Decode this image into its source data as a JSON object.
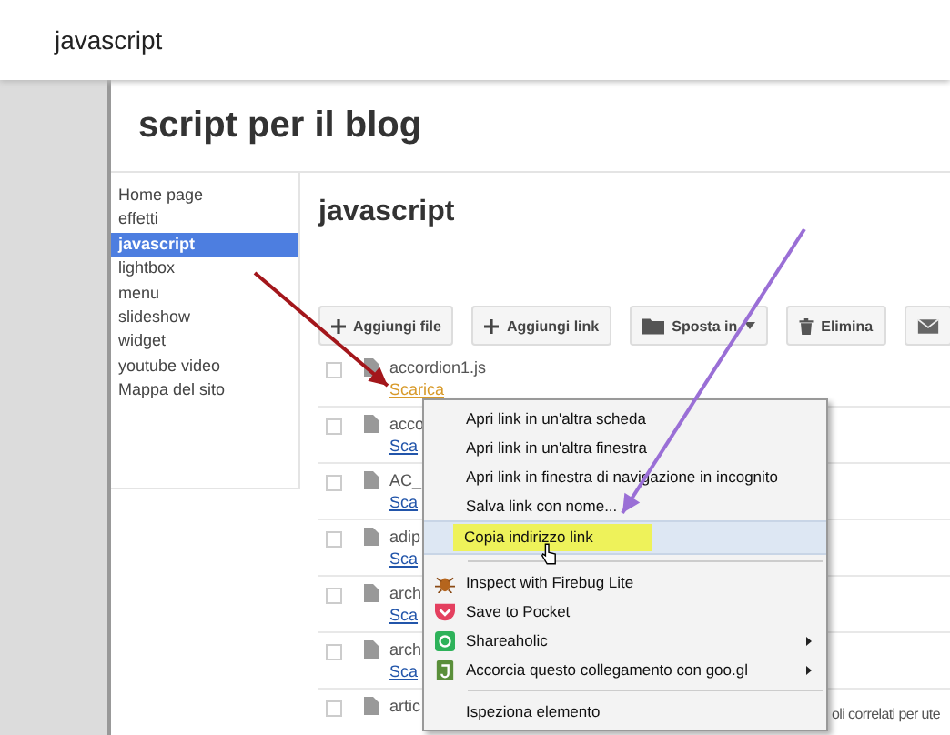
{
  "header": {
    "title": "javascript"
  },
  "site_title": "script per il blog",
  "sidebar": {
    "items": [
      {
        "label": "Home page",
        "selected": false
      },
      {
        "label": "effetti",
        "selected": false
      },
      {
        "label": "javascript",
        "selected": true
      },
      {
        "label": "lightbox",
        "selected": false
      },
      {
        "label": "menu",
        "selected": false
      },
      {
        "label": "slideshow",
        "selected": false
      },
      {
        "label": "widget",
        "selected": false
      },
      {
        "label": "youtube video",
        "selected": false
      },
      {
        "label": "Mappa del sito",
        "selected": false
      }
    ]
  },
  "content": {
    "heading": "javascript",
    "toolbar": [
      {
        "kind": "add",
        "label": "Aggiungi file"
      },
      {
        "kind": "add",
        "label": "Aggiungi link"
      },
      {
        "kind": "move",
        "label": "Sposta in",
        "dropdown": true
      },
      {
        "kind": "delete",
        "label": "Elimina"
      },
      {
        "kind": "mail"
      }
    ],
    "files": [
      {
        "name": "accordion1.js",
        "link": "Scarica",
        "hovered": true,
        "checked": false
      },
      {
        "name": "acco",
        "link": "Sca",
        "hovered": false,
        "checked": false
      },
      {
        "name": "AC_",
        "link": "Sca",
        "hovered": false,
        "checked": false
      },
      {
        "name": "adip",
        "link": "Sca",
        "hovered": false,
        "checked": false
      },
      {
        "name": "arch",
        "link": "Sca",
        "hovered": false,
        "checked": false
      },
      {
        "name": "arch",
        "link": "Sca",
        "hovered": false,
        "checked": false
      },
      {
        "name": "artic",
        "checked": false,
        "note": "oli correlati per ute"
      }
    ]
  },
  "context_menu": {
    "items": [
      {
        "kind": "plain",
        "label": "Apri link in un'altra scheda",
        "highlighted": false
      },
      {
        "kind": "plain",
        "label": "Apri link in un'altra finestra",
        "highlighted": false
      },
      {
        "kind": "plain",
        "label": "Apri link in finestra di navigazione in incognito",
        "highlighted": false
      },
      {
        "kind": "plain",
        "label": "Salva link con nome...",
        "highlighted": false
      },
      {
        "kind": "plain",
        "label": "Copia indirizzo link",
        "highlighted": true
      },
      {
        "kind": "separator"
      },
      {
        "kind": "bug",
        "label": "Inspect with Firebug Lite",
        "highlighted": false
      },
      {
        "kind": "pocket",
        "label": "Save to Pocket",
        "highlighted": false
      },
      {
        "kind": "share",
        "label": "Shareaholic",
        "highlighted": false,
        "submenu": true
      },
      {
        "kind": "shorten",
        "label": "Accorcia questo collegamento con goo.gl",
        "highlighted": false,
        "submenu": true
      },
      {
        "kind": "separator"
      },
      {
        "kind": "plain",
        "label": "Ispeziona elemento",
        "highlighted": false
      }
    ]
  },
  "annotations": [
    {
      "color": "#a3161b"
    },
    {
      "color": "#9a6fd6"
    }
  ]
}
